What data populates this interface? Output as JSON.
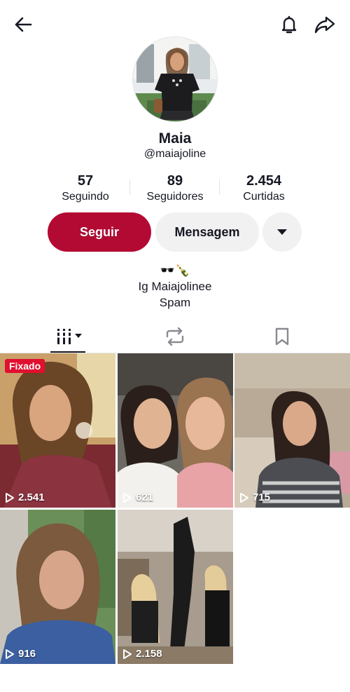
{
  "topbar": {
    "back_icon": "arrow-left-icon",
    "bell_icon": "bell-icon",
    "share_icon": "share-arrow-icon"
  },
  "profile": {
    "name": "Maia",
    "handle": "@maiajoline"
  },
  "stats": [
    {
      "value": "57",
      "label": "Seguindo"
    },
    {
      "value": "89",
      "label": "Seguidores"
    },
    {
      "value": "2.454",
      "label": "Curtidas"
    }
  ],
  "actions": {
    "follow_label": "Seguir",
    "message_label": "Mensagem",
    "more_icon": "caret-down-icon"
  },
  "bio": {
    "line1": "🕶️🍾",
    "line2": "Ig  Maiajolinee",
    "line3": "Spam"
  },
  "tabs": [
    {
      "name": "videos",
      "icon": "grid-bars-icon",
      "active": true
    },
    {
      "name": "reposts",
      "icon": "repost-icon",
      "active": false
    },
    {
      "name": "saved",
      "icon": "bookmark-icon",
      "active": false
    }
  ],
  "videos": [
    {
      "views": "2.541",
      "pinned_label": "Fixado"
    },
    {
      "views": "621"
    },
    {
      "views": "715"
    },
    {
      "views": "916"
    },
    {
      "views": "2.158"
    }
  ],
  "colors": {
    "follow_button": "#b30a34",
    "secondary_button": "#f1f1f2",
    "pinned_badge": "#e0102f",
    "text": "#161823"
  }
}
